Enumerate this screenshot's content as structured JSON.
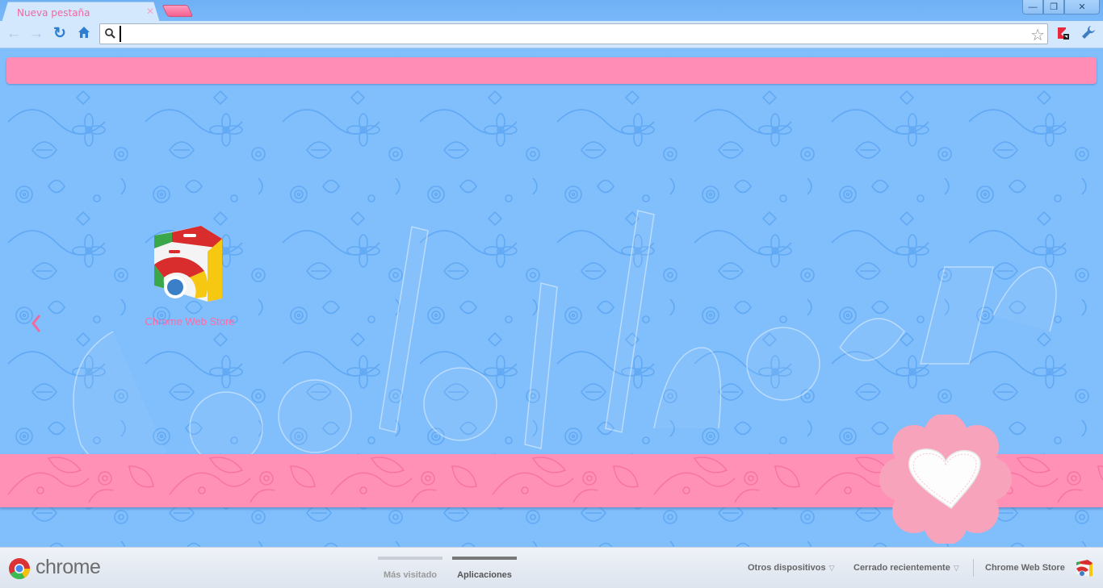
{
  "browser": {
    "tab": {
      "title": "Nueva pestaña",
      "close_icon": "close-icon"
    },
    "new_tab_icon": "new-tab-icon",
    "window_controls": {
      "minimize": "—",
      "restore": "❐",
      "close": "✕"
    },
    "toolbar": {
      "back_icon": "←",
      "forward_icon": "→",
      "reload_icon": "↻",
      "home_icon": "⌂",
      "omnibox_value": "",
      "omnibox_placeholder": "",
      "star_icon": "☆",
      "wrench_icon": "🔧"
    }
  },
  "theme": {
    "background": "#80befc",
    "pattern_color": "#5aa6f5",
    "pink": "#ff8db5",
    "tab_text": "#f0679f"
  },
  "apps": [
    {
      "name": "Chrome Web Store"
    }
  ],
  "footer": {
    "brand": "chrome",
    "tabs": [
      {
        "label": "Más visitado",
        "active": false
      },
      {
        "label": "Aplicaciones",
        "active": true
      }
    ],
    "links": {
      "other_devices": "Otros dispositivos",
      "recently_closed": "Cerrado recientemente",
      "web_store": "Chrome Web Store"
    },
    "caret": "▽"
  }
}
